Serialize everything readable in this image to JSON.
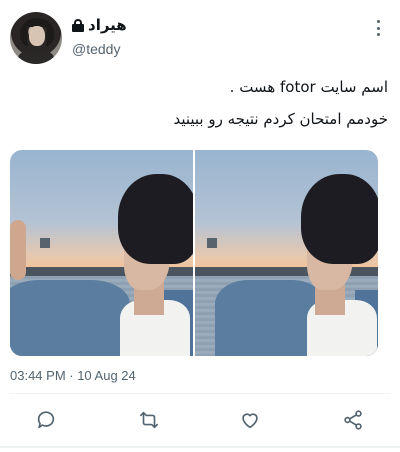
{
  "user": {
    "display_name": "هیراد",
    "handle": "@teddy",
    "locked": true
  },
  "tweet": {
    "line1": "اسم سایت fotor هست .",
    "line2": "خودمم امتحان کردم نتیجه رو ببینید",
    "timestamp": "03:44 PM · 10 Aug 24"
  },
  "media": {
    "image_count": 2
  },
  "actions": {
    "reply_icon": "reply-icon",
    "retweet_icon": "retweet-icon",
    "like_icon": "like-icon",
    "share_icon": "share-icon"
  },
  "colors": {
    "text": "#0f1419",
    "secondary": "#536471",
    "divider": "#eff3f4"
  }
}
